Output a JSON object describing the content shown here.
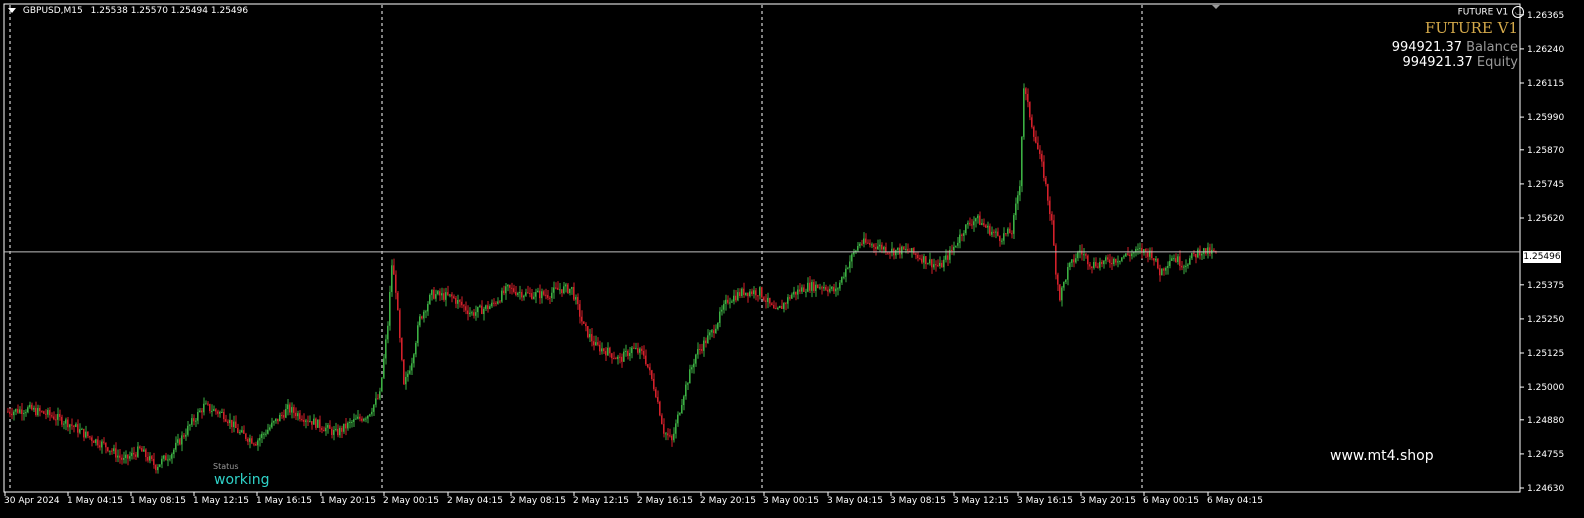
{
  "header": {
    "symbol": "GBPUSD,M15",
    "ohlc": "1.25538 1.25570 1.25494 1.25496"
  },
  "ea": {
    "label": "FUTURE V1",
    "title": "FUTURE V1",
    "balance_value": "994921.37",
    "balance_label": "Balance",
    "equity_value": "994921.37",
    "equity_label": "Equity"
  },
  "status": {
    "caption": "Status",
    "value": "working"
  },
  "watermark": "www.mt4.shop",
  "current_price": "1.25496",
  "colors": {
    "background": "#000000",
    "bull": "#3cb043",
    "bear": "#d3202a",
    "grid": "#ffffff",
    "accent": "#d4a94a",
    "status": "#2fd2c8"
  },
  "chart_data": {
    "type": "candlestick",
    "ylim": [
      1.2463,
      1.2639
    ],
    "price_ticks": [
      "1.26365",
      "1.26240",
      "1.26115",
      "1.25990",
      "1.25870",
      "1.25745",
      "1.25620",
      "1.25375",
      "1.25250",
      "1.25125",
      "1.25000",
      "1.24880",
      "1.24755",
      "1.24630"
    ],
    "time_labels": [
      "30 Apr 2024",
      "1 May 04:15",
      "1 May 08:15",
      "1 May 12:15",
      "1 May 16:15",
      "1 May 20:15",
      "2 May 00:15",
      "2 May 04:15",
      "2 May 08:15",
      "2 May 12:15",
      "2 May 16:15",
      "2 May 20:15",
      "3 May 00:15",
      "3 May 04:15",
      "3 May 08:15",
      "3 May 12:15",
      "3 May 16:15",
      "3 May 20:15",
      "6 May 00:15",
      "6 May 04:15"
    ],
    "session_separators": [
      "2 May 00:15",
      "3 May 00:15",
      "6 May 00:15"
    ],
    "current_price": 1.25496,
    "close_path": [
      [
        0,
        1.2491
      ],
      [
        10,
        1.2492
      ],
      [
        20,
        1.249
      ],
      [
        30,
        1.2487
      ],
      [
        40,
        1.2482
      ],
      [
        50,
        1.2478
      ],
      [
        58,
        1.2473
      ],
      [
        66,
        1.2477
      ],
      [
        74,
        1.2471
      ],
      [
        82,
        1.2476
      ],
      [
        92,
        1.2487
      ],
      [
        98,
        1.2493
      ],
      [
        108,
        1.249
      ],
      [
        116,
        1.2483
      ],
      [
        124,
        1.248
      ],
      [
        132,
        1.2486
      ],
      [
        140,
        1.2492
      ],
      [
        148,
        1.2489
      ],
      [
        156,
        1.2486
      ],
      [
        164,
        1.2483
      ],
      [
        172,
        1.2487
      ],
      [
        180,
        1.249
      ],
      [
        186,
        1.2497
      ],
      [
        188,
        1.251
      ],
      [
        190,
        1.2523
      ],
      [
        192,
        1.2545
      ],
      [
        194,
        1.2536
      ],
      [
        196,
        1.2517
      ],
      [
        198,
        1.25
      ],
      [
        202,
        1.251
      ],
      [
        206,
        1.2525
      ],
      [
        212,
        1.2534
      ],
      [
        222,
        1.2533
      ],
      [
        232,
        1.2527
      ],
      [
        242,
        1.253
      ],
      [
        250,
        1.2536
      ],
      [
        260,
        1.2534
      ],
      [
        270,
        1.2534
      ],
      [
        276,
        1.2536
      ],
      [
        282,
        1.2536
      ],
      [
        288,
        1.2522
      ],
      [
        294,
        1.2515
      ],
      [
        300,
        1.2513
      ],
      [
        306,
        1.251
      ],
      [
        312,
        1.2514
      ],
      [
        318,
        1.2512
      ],
      [
        324,
        1.2498
      ],
      [
        328,
        1.2484
      ],
      [
        332,
        1.248
      ],
      [
        338,
        1.2498
      ],
      [
        344,
        1.2512
      ],
      [
        352,
        1.252
      ],
      [
        360,
        1.2532
      ],
      [
        368,
        1.2535
      ],
      [
        376,
        1.2535
      ],
      [
        384,
        1.2527
      ],
      [
        392,
        1.2534
      ],
      [
        400,
        1.2537
      ],
      [
        408,
        1.2537
      ],
      [
        414,
        1.2535
      ],
      [
        420,
        1.2545
      ],
      [
        426,
        1.2553
      ],
      [
        434,
        1.2552
      ],
      [
        442,
        1.255
      ],
      [
        450,
        1.255
      ],
      [
        458,
        1.2547
      ],
      [
        466,
        1.2544
      ],
      [
        472,
        1.255
      ],
      [
        478,
        1.2558
      ],
      [
        484,
        1.2562
      ],
      [
        490,
        1.2558
      ],
      [
        496,
        1.2555
      ],
      [
        502,
        1.2557
      ],
      [
        506,
        1.2575
      ],
      [
        508,
        1.261
      ],
      [
        510,
        1.2603
      ],
      [
        514,
        1.259
      ],
      [
        518,
        1.2578
      ],
      [
        522,
        1.256
      ],
      [
        524,
        1.2543
      ],
      [
        526,
        1.2533
      ],
      [
        530,
        1.2543
      ],
      [
        536,
        1.255
      ],
      [
        542,
        1.2545
      ],
      [
        550,
        1.2546
      ],
      [
        558,
        1.2548
      ],
      [
        566,
        1.255
      ],
      [
        572,
        1.2549
      ],
      [
        576,
        1.2542
      ],
      [
        582,
        1.2548
      ],
      [
        588,
        1.2545
      ],
      [
        596,
        1.255
      ],
      [
        604,
        1.2549
      ]
    ]
  }
}
